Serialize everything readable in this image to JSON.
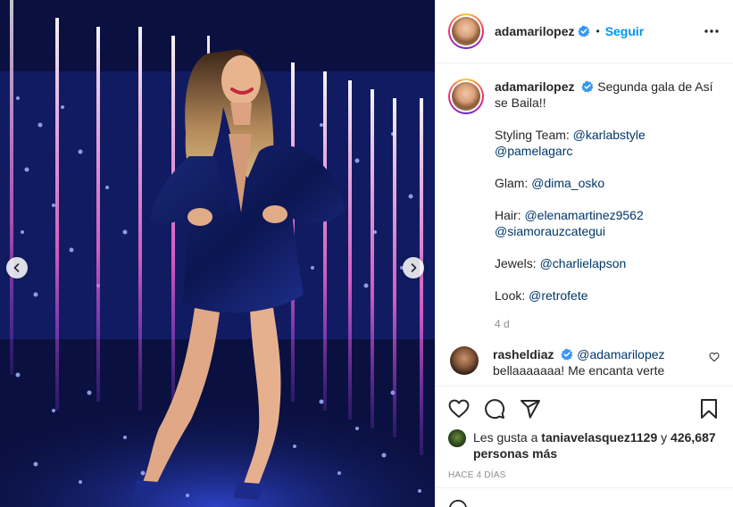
{
  "post": {
    "username": "adamarilopez",
    "follow_label": "Seguir",
    "separator": "•",
    "caption_lines": [
      "Segunda gala de Así se Baila!!"
    ],
    "styling_label": "Styling Team:",
    "styling_mention_1": "@karlabstyle",
    "styling_mention_2": "@pamelagarc",
    "glam_label": "Glam:",
    "glam_mention": "@dima_osko",
    "hair_label": "Hair:",
    "hair_mention_1": "@elenamartinez9562",
    "hair_mention_2": "@siamorauzcategui",
    "jewels_label": "Jewels:",
    "jewels_mention": "@charlielapson",
    "look_label": "Look:",
    "look_mention": "@retrofete",
    "caption_age": "4 d"
  },
  "comment": {
    "username": "rasheldiaz",
    "mention": "@adamarilopez",
    "text": "bellaaaaaaa! Me encanta verte"
  },
  "likes": {
    "prefix": "Les gusta a",
    "user": "taniavelasquez1129",
    "connector": "y",
    "count_text": "426,687 personas más"
  },
  "posted_time": "HACE 4 DÍAS",
  "icons": {
    "verified": "verified-badge-icon",
    "more": "more-options-icon",
    "heart": "heart-icon",
    "comment": "comment-icon",
    "share": "share-icon",
    "save": "bookmark-icon",
    "prev": "chevron-left-icon",
    "next": "chevron-right-icon"
  },
  "colors": {
    "accent": "#0095f6",
    "mention": "#00376b",
    "verified": "#3897f0",
    "muted": "#8e8e8e"
  }
}
